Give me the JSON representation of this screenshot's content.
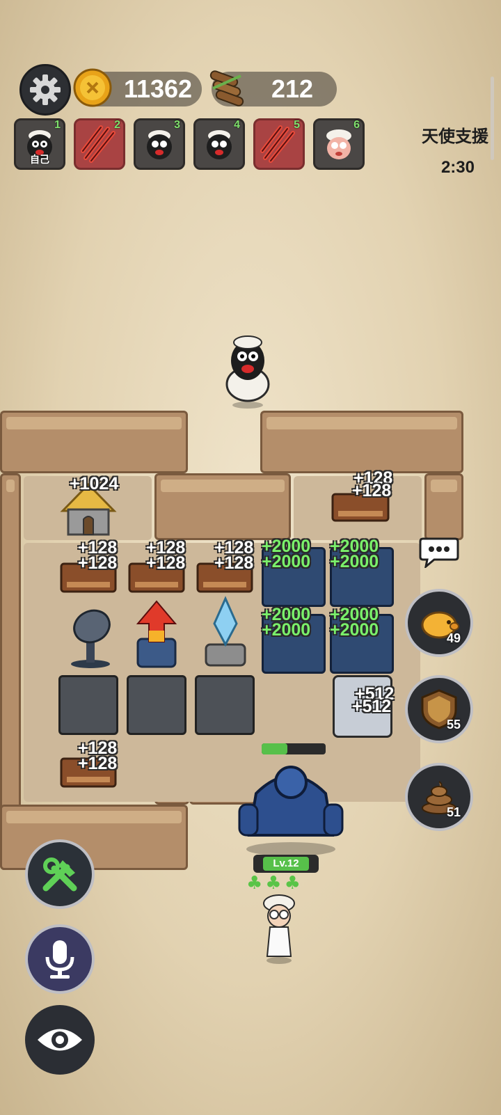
{
  "hud": {
    "coins": "11362",
    "wood": "212",
    "angel_label": "天使支援",
    "angel_timer": "2:30"
  },
  "players": [
    {
      "num": "1",
      "tag": "自己",
      "state": "sheep-black"
    },
    {
      "num": "2",
      "tag": "",
      "state": "attacked"
    },
    {
      "num": "3",
      "tag": "",
      "state": "sheep-black"
    },
    {
      "num": "4",
      "tag": "",
      "state": "sheep-black"
    },
    {
      "num": "5",
      "tag": "",
      "state": "attacked"
    },
    {
      "num": "6",
      "tag": "",
      "state": "sheep-pink"
    }
  ],
  "floats": {
    "house_coin": "+1024",
    "wood_top_right_a": "+128",
    "wood_top_right_b": "+128",
    "wood_row2_1a": "+128",
    "wood_row2_1b": "+128",
    "wood_row2_2a": "+128",
    "wood_row2_2b": "+128",
    "wood_row2_3a": "+128",
    "wood_row2_3b": "+128",
    "green_1a": "+2000",
    "green_1b": "+2000",
    "green_2a": "+2000",
    "green_2b": "+2000",
    "green_3a": "+2000",
    "green_3b": "+2000",
    "green_4a": "+2000",
    "green_4b": "+2000",
    "bed_coin_a": "+512",
    "bed_coin_b": "+512",
    "wood_bottom_a": "+128",
    "wood_bottom_b": "+128"
  },
  "side_buttons": {
    "piggy_count": "49",
    "shield_count": "55",
    "poop_count": "51"
  },
  "monster": {
    "level": "Lv.12"
  },
  "colors": {
    "hp_green": "#57c04a",
    "alert_red": "#a94343",
    "gain_green": "#7af06b"
  }
}
